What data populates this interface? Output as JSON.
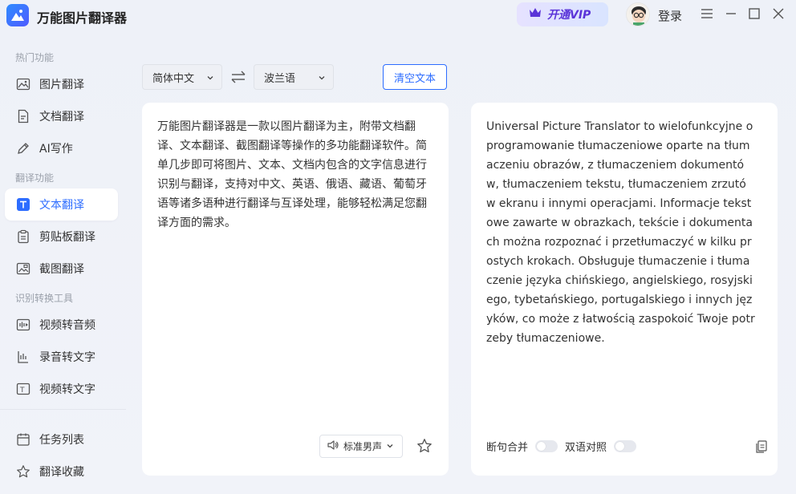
{
  "app": {
    "title": "万能图片翻译器",
    "vip_label": "开通VIP",
    "login_label": "登录"
  },
  "sidebar": {
    "sections": [
      {
        "title": "热门功能"
      },
      {
        "title": "翻译功能"
      },
      {
        "title": "识别转换工具"
      }
    ],
    "items": [
      {
        "label": "图片翻译",
        "icon": "image-icon"
      },
      {
        "label": "文档翻译",
        "icon": "document-icon"
      },
      {
        "label": "AI写作",
        "icon": "pen-icon"
      },
      {
        "label": "文本翻译",
        "icon": "text-icon",
        "active": true
      },
      {
        "label": "剪贴板翻译",
        "icon": "clipboard-icon"
      },
      {
        "label": "截图翻译",
        "icon": "screenshot-icon"
      },
      {
        "label": "视频转音频",
        "icon": "video-audio-icon"
      },
      {
        "label": "录音转文字",
        "icon": "recording-icon"
      },
      {
        "label": "视频转文字",
        "icon": "video-text-icon"
      },
      {
        "label": "任务列表",
        "icon": "calendar-icon"
      },
      {
        "label": "翻译收藏",
        "icon": "star-icon"
      }
    ]
  },
  "toolbar": {
    "source_lang": "简体中文",
    "target_lang": "波兰语",
    "clear_label": "清空文本"
  },
  "source": {
    "text": "万能图片翻译器是一款以图片翻译为主，附带文档翻译、文本翻译、截图翻译等操作的多功能翻译软件。简单几步即可将图片、文本、文档内包含的文字信息进行识别与翻译，支持对中文、英语、俄语、藏语、葡萄牙语等诸多语种进行翻译与互译处理，能够轻松满足您翻译方面的需求。",
    "voice_label": "标准男声"
  },
  "result": {
    "text": "Universal Picture Translator to wielofunkcyjne oprogramowanie tłumaczeniowe oparte na tłumaczeniu obrazów, z tłumaczeniem dokumentów, tłumaczeniem tekstu, tłumaczeniem zrzutów ekranu i innymi operacjami. Informacje tekstowe zawarte w obrazkach, tekście i dokumentach można rozpoznać i przetłumaczyć w kilku prostych krokach. Obsługuje tłumaczenie i tłumaczenie języka chińskiego, angielskiego, rosyjskiego, tybetańskiego, portugalskiego i innych języków, co może z łatwością zaspokoić Twoje potrzeby tłumaczeniowe.",
    "merge_label": "断句合并",
    "merge_on": false,
    "bilingual_label": "双语对照",
    "bilingual_on": false
  },
  "colors": {
    "accent": "#2d6dff",
    "vip_text": "#5a33d8"
  }
}
